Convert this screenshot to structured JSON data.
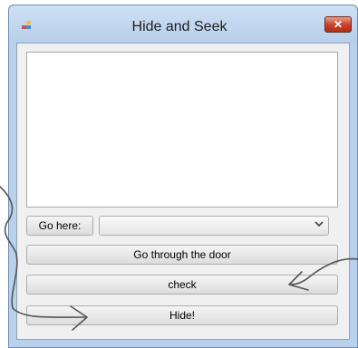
{
  "window": {
    "title": "Hide and Seek",
    "close_glyph": "✕"
  },
  "main": {
    "description_text": "",
    "go_here_label": "Go here:",
    "exits_selected": "",
    "go_through_door_label": "Go through the door",
    "check_label": "check",
    "hide_label": "Hide!"
  },
  "icons": {
    "app": "app-icon",
    "close": "close-icon",
    "dropdown": "chevron-down-icon"
  },
  "colors": {
    "titlebar": "#cde0f4",
    "frame": "#b9d1ea",
    "client": "#f0f0f0",
    "close_button": "#c9452d",
    "annotation_stroke": "#555555"
  }
}
